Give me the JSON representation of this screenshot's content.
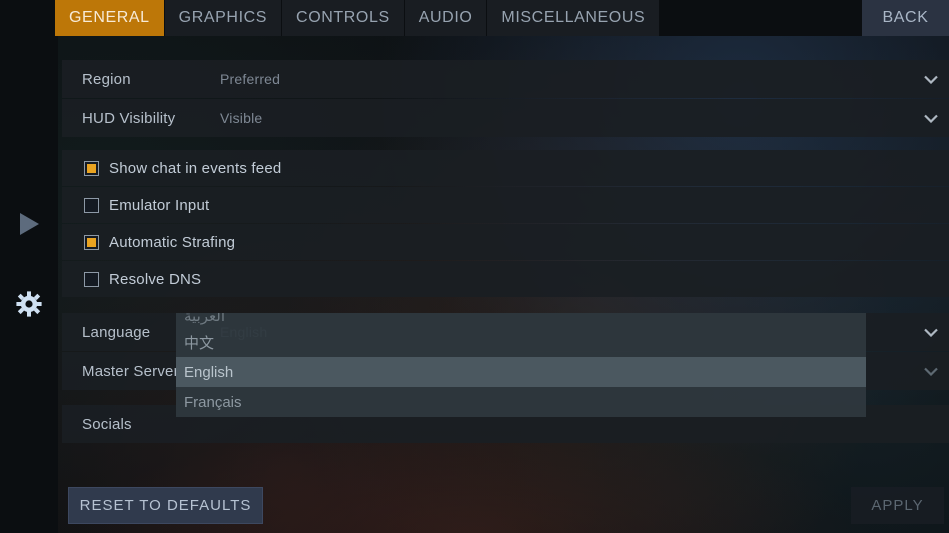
{
  "tabs": [
    {
      "label": "GENERAL",
      "active": true
    },
    {
      "label": "GRAPHICS",
      "active": false
    },
    {
      "label": "CONTROLS",
      "active": false
    },
    {
      "label": "AUDIO",
      "active": false
    },
    {
      "label": "MISCELLANEOUS",
      "active": false
    }
  ],
  "back_button": {
    "label": "BACK"
  },
  "rail": {
    "play_icon": "play-icon",
    "gear_icon": "gear-icon"
  },
  "settings": {
    "dropdowns": [
      {
        "label": "Region",
        "value": "Preferred",
        "icon": "chevron-down-icon"
      },
      {
        "label": "HUD Visibility",
        "value": "Visible",
        "icon": "chevron-down-icon"
      }
    ],
    "checkboxes": [
      {
        "label": "Show chat in events feed",
        "checked": true
      },
      {
        "label": "Emulator Input",
        "checked": false
      },
      {
        "label": "Automatic Strafing",
        "checked": true
      },
      {
        "label": "Resolve DNS",
        "checked": false
      }
    ],
    "lower_rows": [
      {
        "label": "Language",
        "value": "English",
        "icon": "chevron-down-icon"
      },
      {
        "label": "Master Server",
        "value": "",
        "icon": "chevron-down-icon"
      },
      {
        "label": "Socials",
        "value": "",
        "icon": ""
      }
    ]
  },
  "language_dropdown": {
    "open": true,
    "options": [
      {
        "label": "العربية",
        "selected": false
      },
      {
        "label": "中文",
        "selected": false
      },
      {
        "label": "English",
        "selected": true
      },
      {
        "label": "Français",
        "selected": false
      }
    ]
  },
  "footer": {
    "reset_label": "RESET TO DEFAULTS",
    "apply_label": "APPLY"
  },
  "colors": {
    "accent_orange": "#bd7708",
    "checkbox_fill": "#e8a321",
    "back_button_bg": "#2b3342",
    "reset_button_bg": "#303a4d",
    "row_bg": "#1a1e23"
  }
}
